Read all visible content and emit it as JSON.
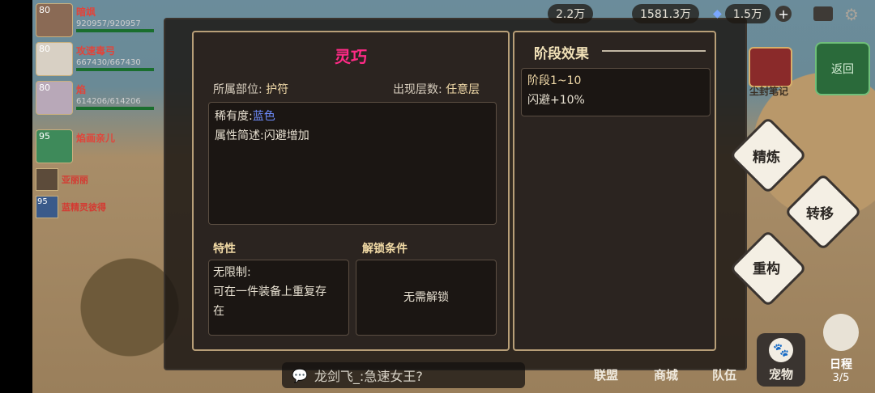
{
  "hud": {
    "currency1": "2.2万",
    "currency2": "1581.3万",
    "currency3": "1.5万",
    "plus": "+"
  },
  "party": [
    {
      "level": "80",
      "name": "暗飒",
      "hp": "920957/920957"
    },
    {
      "level": "80",
      "name": "攻速毒弓",
      "hp": "667430/667430"
    },
    {
      "level": "80",
      "name": "焰",
      "hp": "614206/614206"
    }
  ],
  "party_small": [
    {
      "level": "95",
      "name": "焰画亲儿"
    },
    {
      "level": "",
      "name": "亚丽丽"
    },
    {
      "level": "95",
      "name": "蓝精灵彼得"
    }
  ],
  "right_buttons": {
    "back": "返回",
    "refine": "精炼",
    "transfer": "转移",
    "rebuild": "重构",
    "seal_note": "尘封笔记"
  },
  "bottom_tabs": {
    "alliance": "联盟",
    "shop": "商城",
    "team": "队伍",
    "pet": "宠物",
    "schedule": "日程",
    "schedule_count": "3/5"
  },
  "chat": {
    "text": "龙剑飞_:急速女王?"
  },
  "detail": {
    "title": "灵巧",
    "slot_label": "所属部位:",
    "slot_value": "护符",
    "floor_label": "出现层数:",
    "floor_value": "任意层",
    "rarity_label": "稀有度:",
    "rarity_value": "蓝色",
    "desc_label": "属性简述:",
    "desc_value": "闪避增加",
    "trait_head": "特性",
    "unlock_head": "解锁条件",
    "trait_line1": "无限制:",
    "trait_line2": "可在一件装备上重复存",
    "trait_line3": "在",
    "unlock_text": "无需解锁"
  },
  "stage": {
    "title": "阶段效果",
    "range": "阶段1~10",
    "effect": "闪避+10%"
  },
  "colors": {
    "title_pink": "#ff2a86",
    "rarity_blue": "#6f8dff",
    "panel_border": "#b89f78"
  }
}
